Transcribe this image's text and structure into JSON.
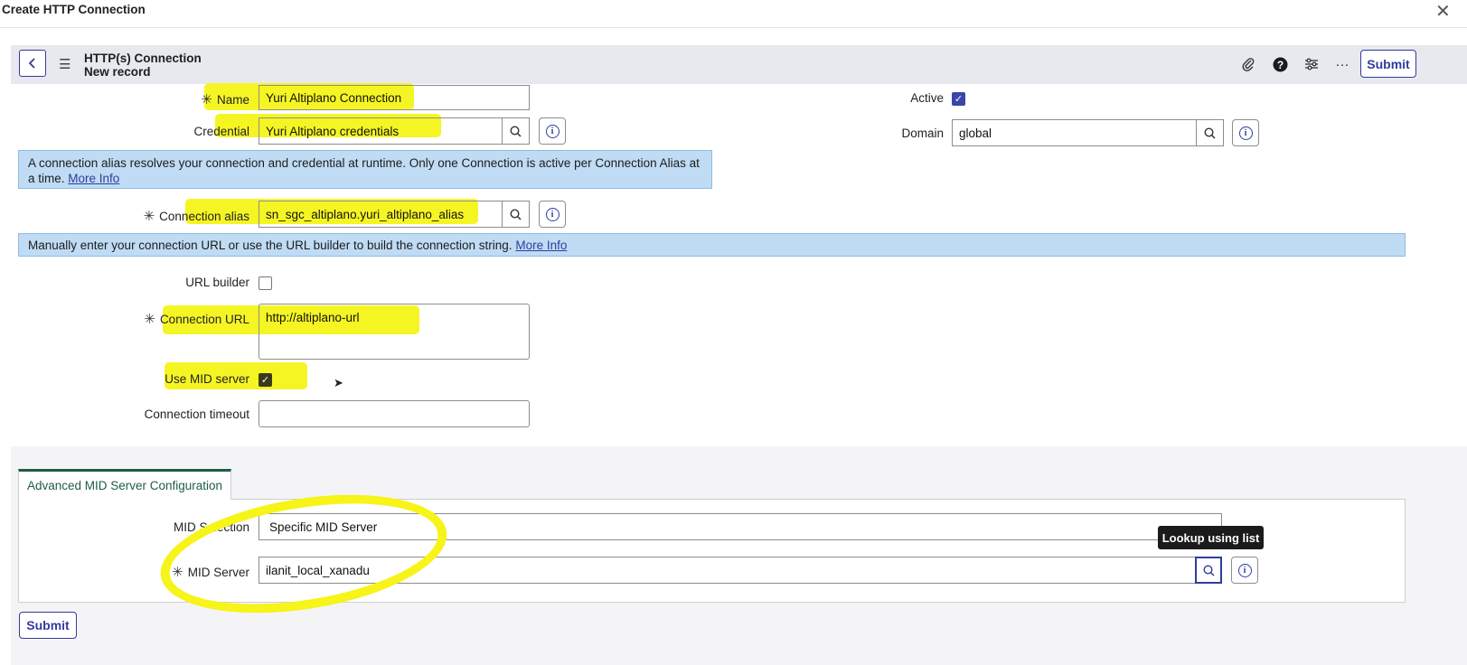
{
  "dialog": {
    "title": "Create HTTP Connection",
    "close_icon": "close-icon"
  },
  "header": {
    "title": "HTTP(s) Connection",
    "subtitle": "New record",
    "submit_label": "Submit",
    "icons": [
      "attachment-icon",
      "help-icon",
      "settings-icon",
      "more-icon"
    ]
  },
  "form": {
    "name": {
      "label": "Name",
      "value": "Yuri Altiplano Connection",
      "required": true
    },
    "credential": {
      "label": "Credential",
      "value": "Yuri Altiplano credentials"
    },
    "active": {
      "label": "Active",
      "checked": true
    },
    "domain": {
      "label": "Domain",
      "value": "global"
    },
    "alias_note": {
      "text": "A connection alias resolves your connection and credential at runtime. Only one Connection is active per Connection Alias at a time.",
      "link": "More Info"
    },
    "connection_alias": {
      "label": "Connection alias",
      "value": "sn_sgc_altiplano.yuri_altiplano_alias",
      "required": true
    },
    "url_note": {
      "text": "Manually enter your connection URL or use the URL builder to build the connection string.",
      "link": "More Info"
    },
    "url_builder": {
      "label": "URL builder",
      "checked": false
    },
    "connection_url": {
      "label": "Connection URL",
      "value": "http://altiplano-url",
      "required": true
    },
    "use_mid_server": {
      "label": "Use MID server",
      "checked": true
    },
    "connection_timeout": {
      "label": "Connection timeout",
      "value": ""
    }
  },
  "advanced": {
    "tab_label": "Advanced MID Server Configuration",
    "mid_selection": {
      "label": "MID Selection",
      "value": "Specific MID Server"
    },
    "mid_server": {
      "label": "MID Server",
      "value": "ilanit_local_xanadu",
      "required": true
    },
    "tooltip": "Lookup using list"
  },
  "footer": {
    "submit_label": "Submit"
  },
  "colors": {
    "accent": "#2f3d9c",
    "highlight": "#f6f418",
    "note_bg": "#bfdcf4",
    "tab_accent": "#1e5c47"
  }
}
